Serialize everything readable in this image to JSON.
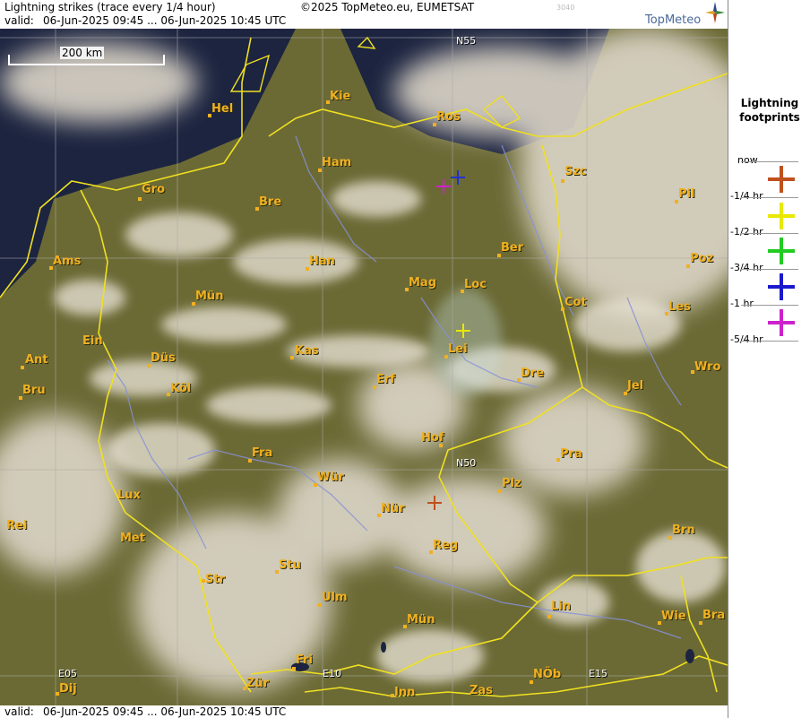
{
  "header": {
    "title": "Lightning strikes (trace every 1/4 hour)",
    "copyright": "©2025 TopMeteo.eu, EUMETSAT",
    "code": "3040",
    "valid_prefix": "valid:",
    "valid_range": "06-Jun-2025 09:45 ... 06-Jun-2025 10:45 UTC",
    "logo_text": "TopMeteo"
  },
  "footer": {
    "valid_prefix": "valid:",
    "valid_range": "06-Jun-2025 09:45 ... 06-Jun-2025 10:45 UTC"
  },
  "map": {
    "scale_label": "200 km",
    "grid_labels": [
      "N55",
      "N50",
      "E05",
      "E10",
      "E15"
    ],
    "cities": [
      "Hel",
      "Kie",
      "Ros",
      "Szc",
      "Ham",
      "Gro",
      "Bre",
      "Pil",
      "Ber",
      "Ams",
      "Han",
      "Poz",
      "Mag",
      "Loc",
      "Mün",
      "Cot",
      "Les",
      "Ein",
      "Lei",
      "Kas",
      "Ant",
      "Düs",
      "Wro",
      "Bru",
      "Köl",
      "Erf",
      "Dre",
      "Jel",
      "Hof",
      "Fra",
      "Pra",
      "Wür",
      "Plz",
      "Lux",
      "Rei",
      "Nür",
      "Met",
      "Reg",
      "Brn",
      "Stu",
      "Str",
      "Ulm",
      "Lin",
      "Mün",
      "Wie",
      "Bra",
      "Fri",
      "Dij",
      "Zür",
      "Inn",
      "Zas",
      "NÖb"
    ]
  },
  "strikes": [
    {
      "age": "-5/4 hr",
      "color": "#cc22cc"
    },
    {
      "age": "-1 hr",
      "color": "#2233cc"
    },
    {
      "age": "-1/2 hr",
      "color": "#e8e800"
    },
    {
      "age": "now",
      "color": "#c0501e"
    }
  ],
  "legend": {
    "title_line1": "Lightning",
    "title_line2": "footprints",
    "items": [
      {
        "label": "now",
        "color": "#c0501e"
      },
      {
        "label": "-1/4 hr",
        "color": "#e8e800"
      },
      {
        "label": "-1/2 hr",
        "color": "#22cc22"
      },
      {
        "label": "-3/4 hr",
        "color": "#1a1acc"
      },
      {
        "label": "-1 hr",
        "color": "#cc22cc"
      },
      {
        "label": "-5/4 hr",
        "color": ""
      }
    ]
  },
  "colors": {
    "land": "#6b6a35",
    "sea": "#1c2440",
    "cloud": "#e8e2d6",
    "border": "#f0e020",
    "river": "#8890d8",
    "city": "#f0b020"
  }
}
